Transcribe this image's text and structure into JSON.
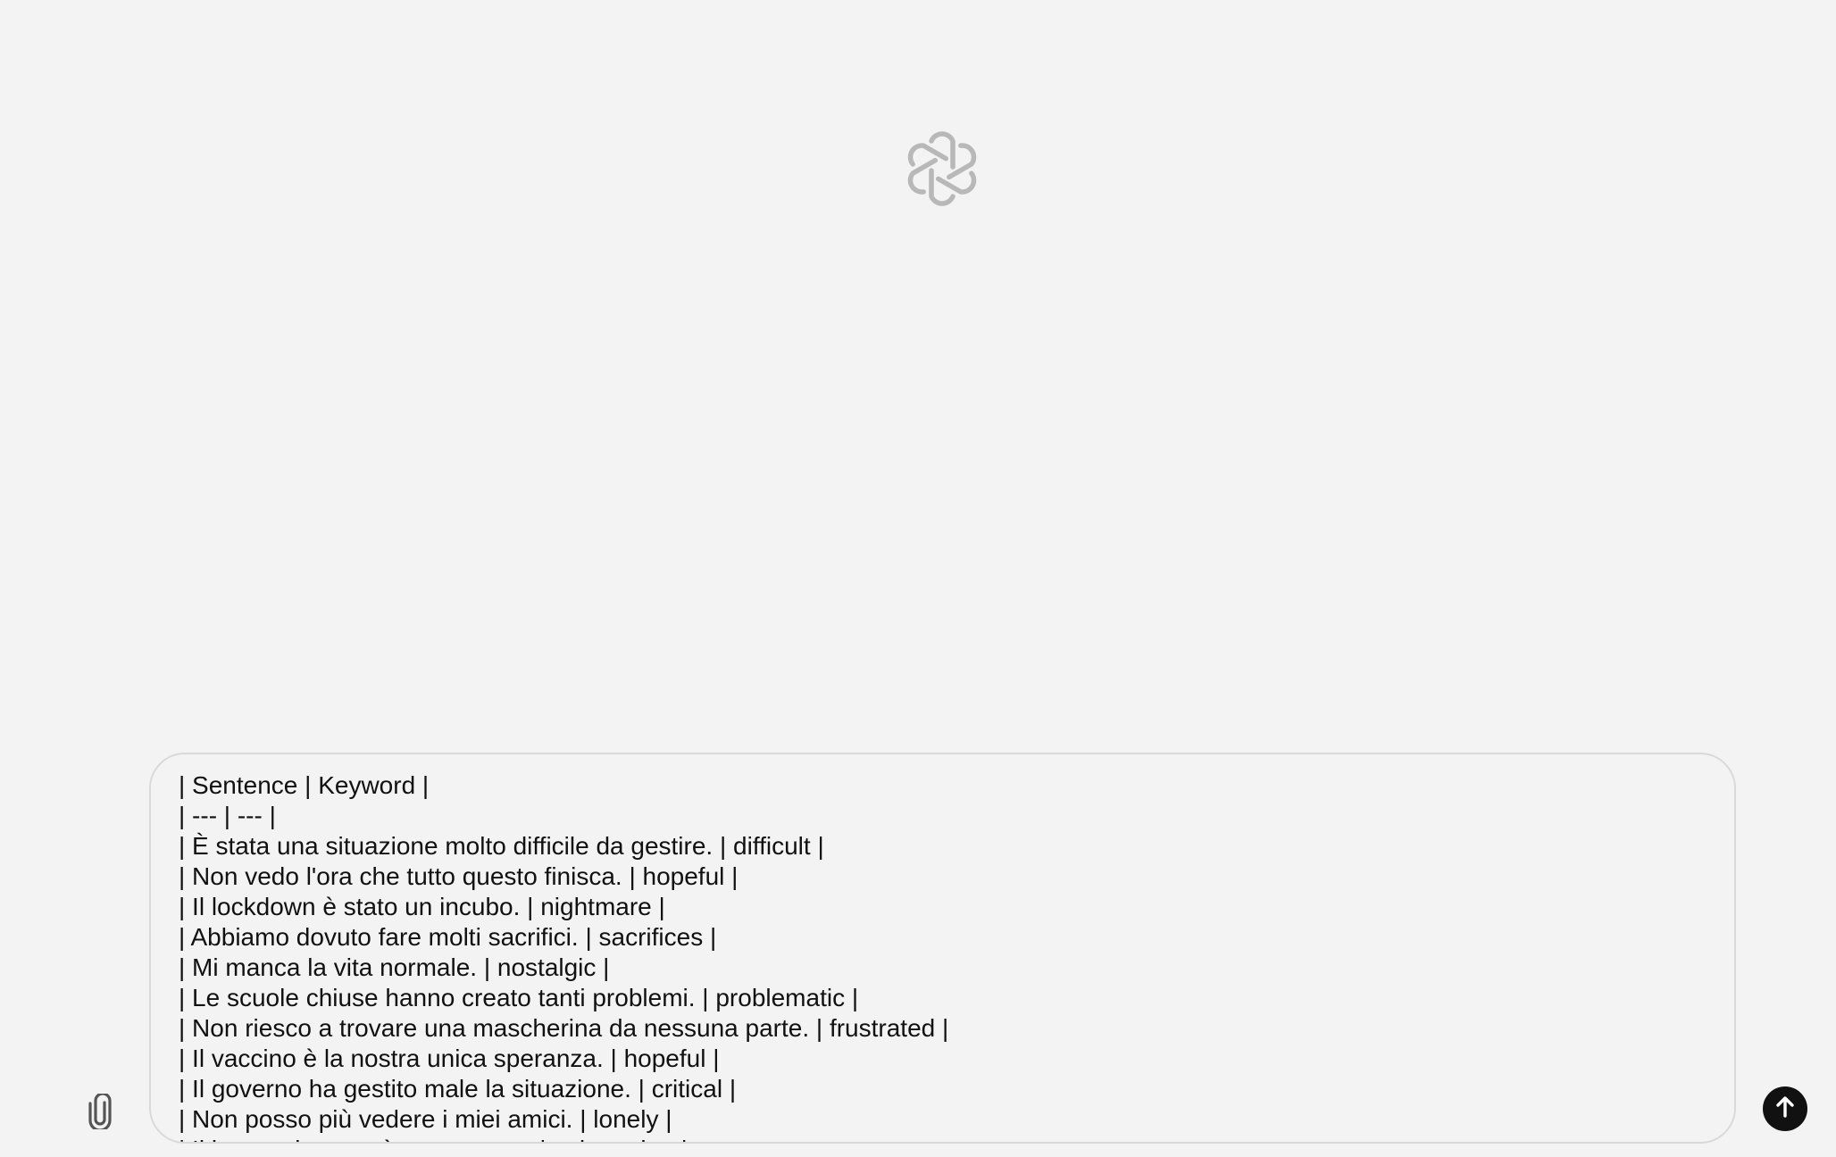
{
  "icons": {
    "logo": "openai-logo-icon",
    "attach": "paperclip-icon",
    "send": "arrow-up-icon"
  },
  "colors": {
    "background": "#f3f3f3",
    "logo": "#b8b8b8",
    "text": "#111111",
    "send_button": "#111111"
  },
  "composer": {
    "lines": [
      "| Sentence | Keyword |",
      "| --- | --- |",
      "| È stata una situazione molto difficile da gestire. | difficult |",
      "| Non vedo l'ora che tutto questo finisca. | hopeful |",
      "| Il lockdown è stato un incubo. | nightmare |",
      "| Abbiamo dovuto fare molti sacrifici. | sacrifices |",
      "| Mi manca la vita normale. | nostalgic |",
      "| Le scuole chiuse hanno creato tanti problemi. | problematic |",
      "| Non riesco a trovare una mascherina da nessuna parte. | frustrated |",
      "| Il vaccino è la nostra unica speranza. | hopeful |",
      "| Il governo ha gestito male la situazione. | critical |",
      "| Non posso più vedere i miei amici. | lonely |",
      "| Il lavoro da casa è estenuante. | exhausting |"
    ]
  }
}
